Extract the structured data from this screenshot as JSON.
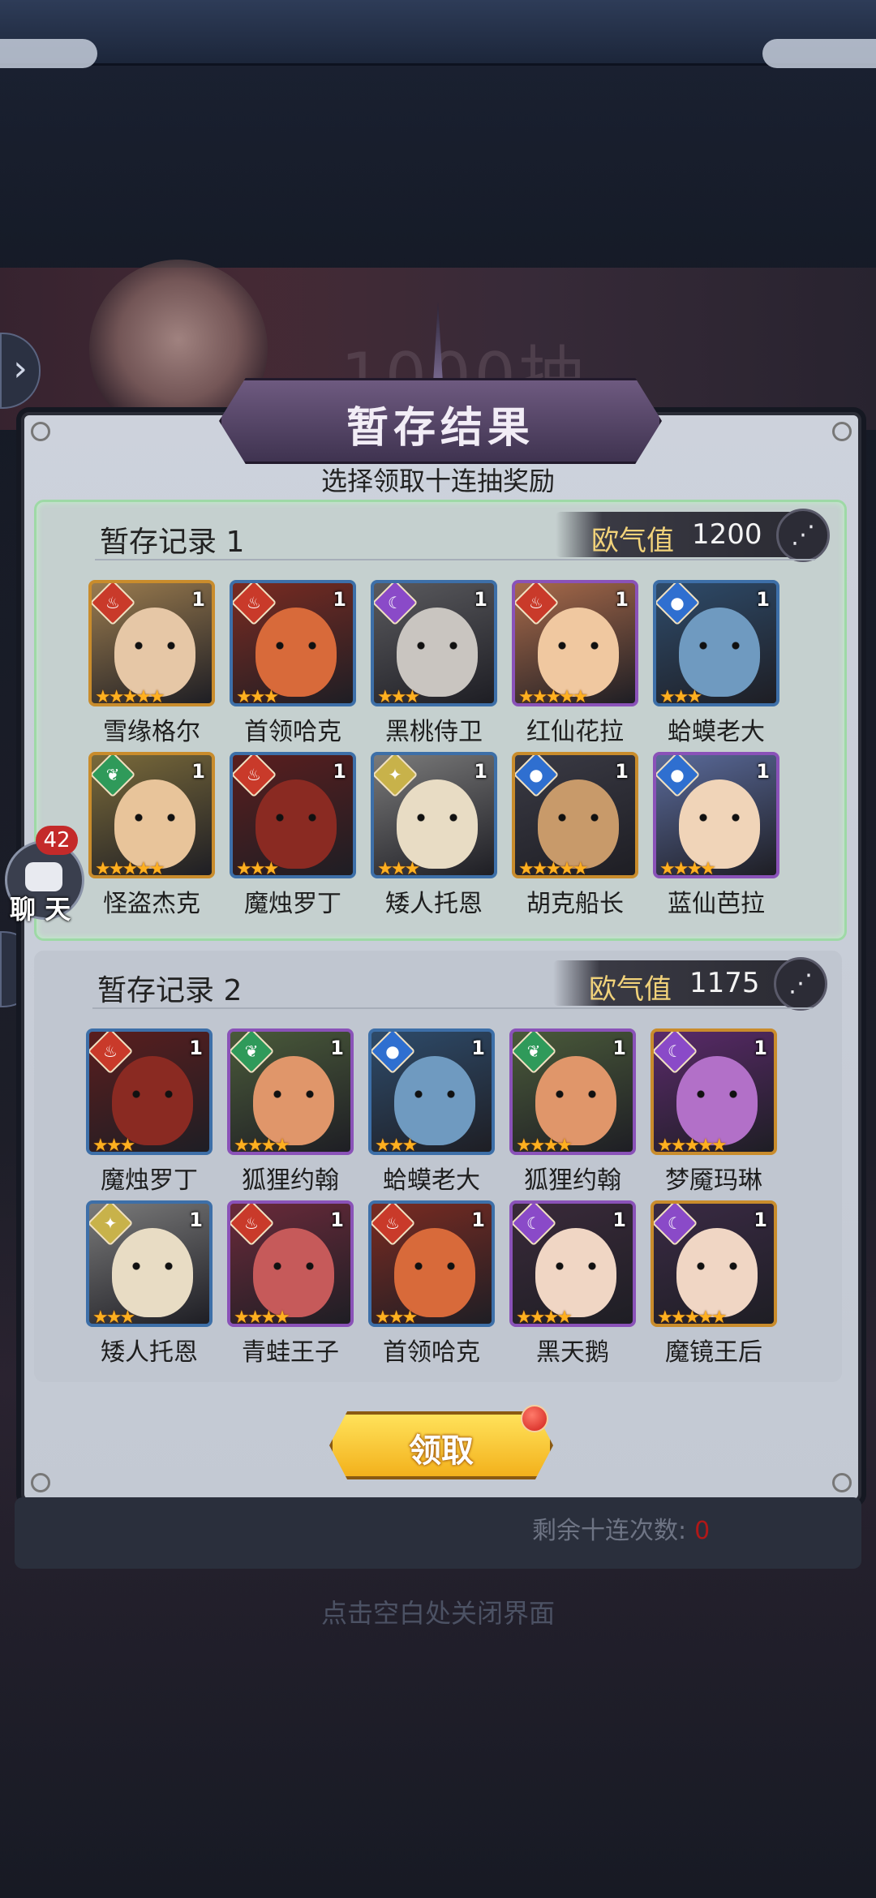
{
  "header": {
    "title": "暂存结果",
    "subtitle": "选择领取十连抽奖励",
    "background_banner_text": "1000抽"
  },
  "colors": {
    "fire": "#c93a2a",
    "water": "#2f6fd0",
    "wind": "#2f9a5a",
    "dark": "#8a4ac8",
    "light": "#c8b24a",
    "luck_label": "#f1d27a",
    "selected_border": "#9ed9a6"
  },
  "records": [
    {
      "title": "暂存记录 1",
      "luck_label": "欧气值",
      "luck_value": "1200",
      "selected": true,
      "heroes": [
        {
          "name": "雪缘格尔",
          "element": "fire",
          "icon": "flame-icon",
          "count": "1",
          "stars": 5,
          "frame": "gold",
          "skin": "#e6c7a6",
          "bg": "#9a7b4e"
        },
        {
          "name": "首领哈克",
          "element": "fire",
          "icon": "flame-icon",
          "count": "1",
          "stars": 3,
          "frame": "blue",
          "skin": "#d86a3a",
          "bg": "#7a2b22"
        },
        {
          "name": "黑桃侍卫",
          "element": "dark",
          "icon": "moon-icon",
          "count": "1",
          "stars": 3,
          "frame": "blue",
          "skin": "#c9c5c0",
          "bg": "#5a5a5e"
        },
        {
          "name": "红仙花拉",
          "element": "fire",
          "icon": "flame-icon",
          "count": "1",
          "stars": 5,
          "frame": "purple",
          "skin": "#f0c8a0",
          "bg": "#a86a4a"
        },
        {
          "name": "蛤蟆老大",
          "element": "water",
          "icon": "drop-icon",
          "count": "1",
          "stars": 3,
          "frame": "blue",
          "skin": "#6f9ac0",
          "bg": "#2e4b6a"
        },
        {
          "name": "怪盗杰克",
          "element": "wind",
          "icon": "leaf-icon",
          "count": "1",
          "stars": 5,
          "frame": "gold",
          "skin": "#e8c49a",
          "bg": "#7a6a3a"
        },
        {
          "name": "魔烛罗丁",
          "element": "fire",
          "icon": "flame-icon",
          "count": "1",
          "stars": 3,
          "frame": "blue",
          "skin": "#8a2a22",
          "bg": "#5a1e1e"
        },
        {
          "name": "矮人托恩",
          "element": "light",
          "icon": "sun-icon",
          "count": "1",
          "stars": 3,
          "frame": "blue",
          "skin": "#e8dcc4",
          "bg": "#7a7a7a"
        },
        {
          "name": "胡克船长",
          "element": "water",
          "icon": "drop-icon",
          "count": "1",
          "stars": 5,
          "frame": "gold",
          "skin": "#c89a6a",
          "bg": "#3a3a44"
        },
        {
          "name": "蓝仙芭拉",
          "element": "water",
          "icon": "drop-icon",
          "count": "1",
          "stars": 4,
          "frame": "purple",
          "skin": "#f0d4b8",
          "bg": "#5a6a9a"
        }
      ]
    },
    {
      "title": "暂存记录 2",
      "luck_label": "欧气值",
      "luck_value": "1175",
      "selected": false,
      "heroes": [
        {
          "name": "魔烛罗丁",
          "element": "fire",
          "icon": "flame-icon",
          "count": "1",
          "stars": 3,
          "frame": "blue",
          "skin": "#8a2a22",
          "bg": "#5a1e1e"
        },
        {
          "name": "狐狸约翰",
          "element": "wind",
          "icon": "leaf-icon",
          "count": "1",
          "stars": 4,
          "frame": "purple",
          "skin": "#e0966a",
          "bg": "#4a5a3a"
        },
        {
          "name": "蛤蟆老大",
          "element": "water",
          "icon": "drop-icon",
          "count": "1",
          "stars": 3,
          "frame": "blue",
          "skin": "#6f9ac0",
          "bg": "#2e4b6a"
        },
        {
          "name": "狐狸约翰",
          "element": "wind",
          "icon": "leaf-icon",
          "count": "1",
          "stars": 4,
          "frame": "purple",
          "skin": "#e0966a",
          "bg": "#4a5a3a"
        },
        {
          "name": "梦魇玛琳",
          "element": "dark",
          "icon": "moon-icon",
          "count": "1",
          "stars": 5,
          "frame": "gold",
          "skin": "#b270c8",
          "bg": "#5a2a6a"
        },
        {
          "name": "矮人托恩",
          "element": "light",
          "icon": "sun-icon",
          "count": "1",
          "stars": 3,
          "frame": "blue",
          "skin": "#e8dcc4",
          "bg": "#7a7a7a"
        },
        {
          "name": "青蛙王子",
          "element": "fire",
          "icon": "flame-icon",
          "count": "1",
          "stars": 4,
          "frame": "purple",
          "skin": "#c65a5a",
          "bg": "#6a2a3a"
        },
        {
          "name": "首领哈克",
          "element": "fire",
          "icon": "flame-icon",
          "count": "1",
          "stars": 3,
          "frame": "blue",
          "skin": "#d86a3a",
          "bg": "#7a2b22"
        },
        {
          "name": "黑天鹅",
          "element": "dark",
          "icon": "moon-icon",
          "count": "1",
          "stars": 4,
          "frame": "purple",
          "skin": "#f0d6c4",
          "bg": "#3a2a3a"
        },
        {
          "name": "魔镜王后",
          "element": "dark",
          "icon": "moon-icon",
          "count": "1",
          "stars": 5,
          "frame": "gold",
          "skin": "#f0d6c4",
          "bg": "#3a2a44"
        }
      ]
    }
  ],
  "claim_button": "领取",
  "remaining_label": "剩余十连次数:",
  "remaining_value": "0",
  "close_hint": "点击空白处关闭界面",
  "chat": {
    "badge": "42",
    "label": "聊 天"
  },
  "icons": {
    "share": "share-icon",
    "arrow": "chevron-right-icon"
  }
}
